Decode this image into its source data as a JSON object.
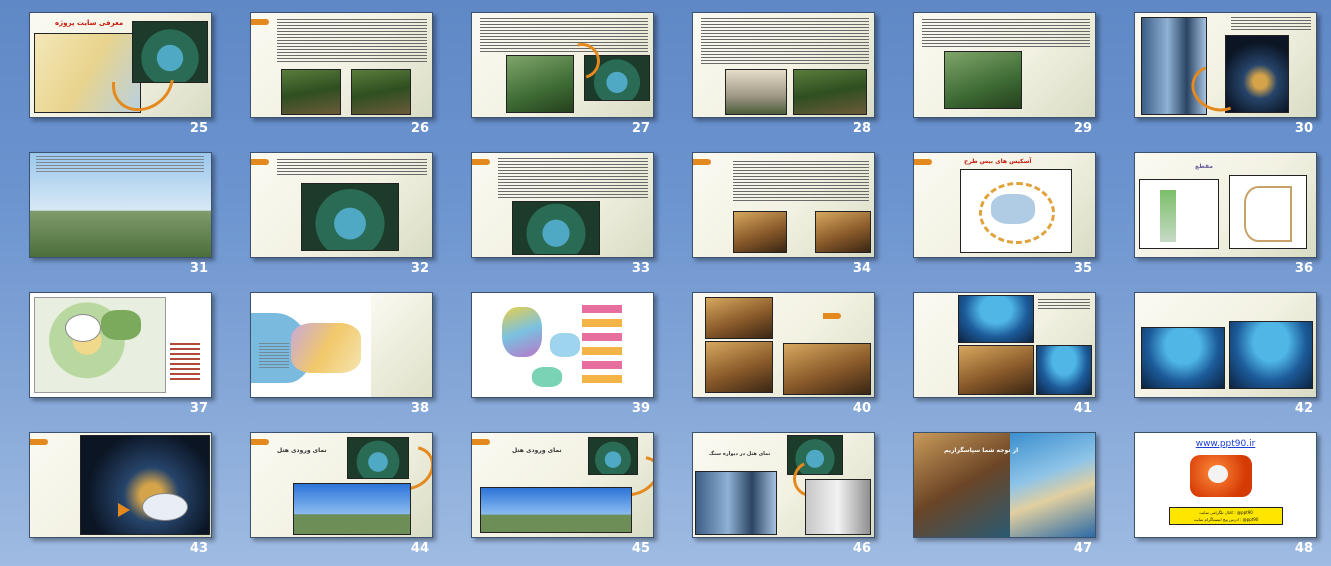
{
  "app": {
    "view": "Slide Sorter"
  },
  "slides": [
    {
      "number": "25",
      "title": "معرفی سایت پروژه",
      "row": 0,
      "col": 0,
      "layout": "map"
    },
    {
      "number": "26",
      "title": "",
      "row": 0,
      "col": 1,
      "layout": "text-two-pics"
    },
    {
      "number": "27",
      "title": "",
      "row": 0,
      "col": 2,
      "layout": "text-pics-arc"
    },
    {
      "number": "28",
      "title": "",
      "row": 0,
      "col": 3,
      "layout": "text-two-pics"
    },
    {
      "number": "29",
      "title": "",
      "row": 0,
      "col": 4,
      "layout": "text-pic-left"
    },
    {
      "number": "30",
      "title": "",
      "row": 0,
      "col": 5,
      "layout": "pics-arc-right"
    },
    {
      "number": "31",
      "title": "",
      "row": 1,
      "col": 0,
      "layout": "photo-full"
    },
    {
      "number": "32",
      "title": "",
      "row": 1,
      "col": 1,
      "layout": "text-pic-center"
    },
    {
      "number": "33",
      "title": "",
      "row": 1,
      "col": 2,
      "layout": "text-pic-center"
    },
    {
      "number": "34",
      "title": "",
      "row": 1,
      "col": 3,
      "layout": "text-two-rooms"
    },
    {
      "number": "35",
      "title": "آسکیس های بیس طرح",
      "row": 1,
      "col": 4,
      "layout": "sketch"
    },
    {
      "number": "36",
      "title": "مقطع",
      "row": 1,
      "col": 5,
      "layout": "two-sections"
    },
    {
      "number": "37",
      "title": "",
      "row": 2,
      "col": 0,
      "layout": "site-plan"
    },
    {
      "number": "38",
      "title": "",
      "row": 2,
      "col": 1,
      "layout": "plan-white"
    },
    {
      "number": "39",
      "title": "",
      "row": 2,
      "col": 2,
      "layout": "diagram-white"
    },
    {
      "number": "40",
      "title": "",
      "row": 2,
      "col": 3,
      "layout": "rooms-grid"
    },
    {
      "number": "41",
      "title": "",
      "row": 2,
      "col": 4,
      "layout": "aqua-pics"
    },
    {
      "number": "42",
      "title": "",
      "row": 2,
      "col": 5,
      "layout": "aqua-two"
    },
    {
      "number": "43",
      "title": "",
      "row": 3,
      "col": 0,
      "layout": "night-arrow"
    },
    {
      "number": "44",
      "title": "نمای ورودی هتل",
      "row": 3,
      "col": 1,
      "layout": "facade-arc"
    },
    {
      "number": "45",
      "title": "نمای ورودی هتل",
      "row": 3,
      "col": 2,
      "layout": "facade-arc"
    },
    {
      "number": "46",
      "title": "نمای هتل در دیواره سنگ",
      "row": 3,
      "col": 3,
      "layout": "tower-arc"
    },
    {
      "number": "47",
      "title": "از توجه شما سپاسگزاریم",
      "row": 3,
      "col": 4,
      "layout": "thanks"
    },
    {
      "number": "48",
      "title": "",
      "row": 3,
      "col": 5,
      "layout": "brand"
    }
  ],
  "brand_slide": {
    "url": "www.ppt90.ir",
    "line1": "کانال تلگرامی سایت : @ppt90",
    "line2": "ادرس پیج اینستاگرام سایت : @ppt90"
  },
  "colors": {
    "background": "#6c94cf",
    "accent": "#e4891e",
    "slide_number": "#ffffff"
  }
}
